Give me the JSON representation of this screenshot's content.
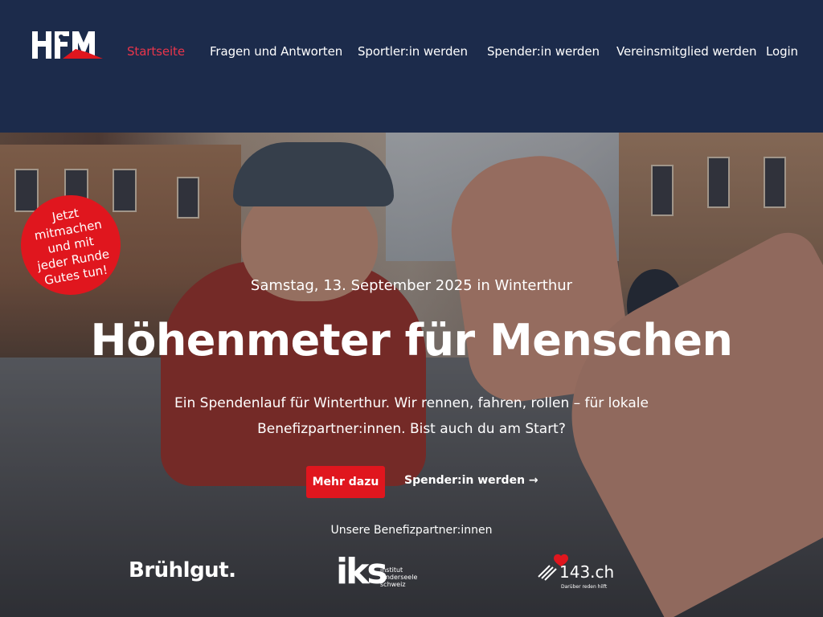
{
  "logo": {
    "text": "HFM"
  },
  "nav": {
    "items": [
      {
        "label": "Startseite",
        "active": true
      },
      {
        "label": "Fragen und Antworten",
        "active": false
      },
      {
        "label": "Sportler:in werden",
        "active": false
      },
      {
        "label": "Spender:in werden",
        "active": false
      },
      {
        "label": "Vereinsmitglied werden",
        "active": false
      },
      {
        "label": "Login",
        "active": false
      }
    ]
  },
  "badge": {
    "text": "Jetzt\nmitmachen\nund mit\njeder Runde\nGutes tun!"
  },
  "hero": {
    "date": "Samstag, 13. September 2025 in Winterthur",
    "title": "Höhenmeter für Menschen",
    "description_line1": "Ein Spendenlauf für Winterthur. Wir rennen, fahren, rollen – für lokale",
    "description_line2": "Benefizpartner:innen. Bist auch du am Start?",
    "primary_button": "Mehr dazu",
    "secondary_link": "Spender:in werden →"
  },
  "partners": {
    "label": "Unsere Benefizpartner:innen",
    "items": [
      {
        "name": "Brühlgut."
      },
      {
        "name": "iks",
        "sub": "institut\nkinderseele\nschweiz"
      },
      {
        "name": "143.ch",
        "tag": "Darüber reden hilft"
      }
    ]
  },
  "colors": {
    "header_bg": "#1c2b4b",
    "accent": "#e0161e",
    "nav_active": "#e8354b"
  }
}
